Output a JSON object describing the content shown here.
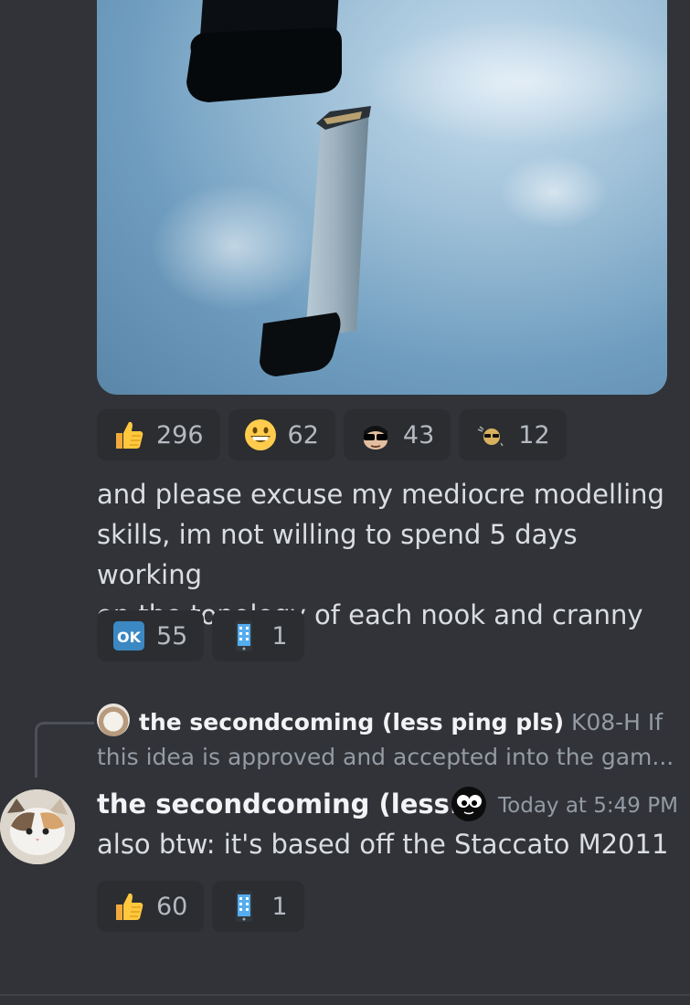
{
  "messages": [
    {
      "reactions_image": [
        {
          "emoji": "thumbs-up-icon",
          "count": "296"
        },
        {
          "emoji": "grinning-face-icon",
          "count": "62"
        },
        {
          "emoji": "sunglasses-face-icon",
          "count": "43"
        },
        {
          "emoji": "sunglasses-small-icon",
          "count": "12"
        }
      ],
      "text_lines": [
        "and please excuse my mediocre modelling",
        "skills, im not willing to spend 5 days working",
        "on the topology of each nook and cranny"
      ],
      "reactions_text": [
        {
          "emoji": "ok-button-icon",
          "count": "55"
        },
        {
          "emoji": "mobile-phone-icon",
          "count": "1"
        }
      ]
    },
    {
      "reply": {
        "name": "the secondcoming (less ping pls)",
        "preview_line1": "K08-H  If",
        "preview_line2": "this idea is approved and accepted into the gam..."
      },
      "author": "the secondcoming (less...",
      "timestamp": "Today at 5:49 PM",
      "text": "also btw: it's based off the Staccato M2011",
      "reactions": [
        {
          "emoji": "thumbs-up-icon",
          "count": "60"
        },
        {
          "emoji": "mobile-phone-icon",
          "count": "1"
        }
      ]
    }
  ],
  "colors": {
    "background": "#313338",
    "reaction_bg": "#2b2d31",
    "text": "#dbdee1",
    "muted": "#949ba4"
  }
}
